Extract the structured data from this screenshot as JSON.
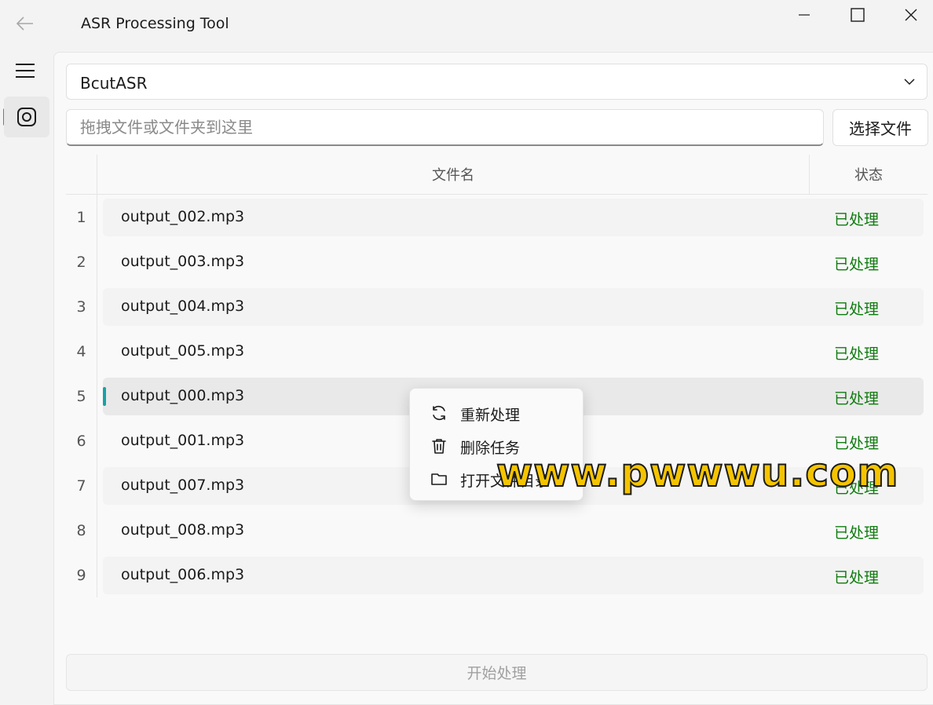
{
  "titlebar": {
    "title": "ASR Processing Tool"
  },
  "engine_select": {
    "value": "BcutASR"
  },
  "file_input": {
    "placeholder": "拖拽文件或文件夹到这里",
    "button_label": "选择文件"
  },
  "table": {
    "headers": {
      "name": "文件名",
      "status": "状态"
    },
    "rows": [
      {
        "num": "1",
        "name": "output_002.mp3",
        "status": "已处理"
      },
      {
        "num": "2",
        "name": "output_003.mp3",
        "status": "已处理"
      },
      {
        "num": "3",
        "name": "output_004.mp3",
        "status": "已处理"
      },
      {
        "num": "4",
        "name": "output_005.mp3",
        "status": "已处理"
      },
      {
        "num": "5",
        "name": "output_000.mp3",
        "status": "已处理"
      },
      {
        "num": "6",
        "name": "output_001.mp3",
        "status": "已处理"
      },
      {
        "num": "7",
        "name": "output_007.mp3",
        "status": "已处理"
      },
      {
        "num": "8",
        "name": "output_008.mp3",
        "status": "已处理"
      },
      {
        "num": "9",
        "name": "output_006.mp3",
        "status": "已处理"
      }
    ],
    "selected_row": "5"
  },
  "context_menu": {
    "items": [
      {
        "label": "重新处理",
        "icon": "refresh-icon"
      },
      {
        "label": "删除任务",
        "icon": "trash-icon"
      },
      {
        "label": "打开文件目录",
        "icon": "folder-icon"
      }
    ]
  },
  "start_button": {
    "label": "开始处理"
  },
  "watermark": {
    "text": "www.pwwwu.com"
  },
  "colors": {
    "accent": "#17a2a8",
    "status_done": "#0f7b0f",
    "watermark": "#f5c400"
  }
}
